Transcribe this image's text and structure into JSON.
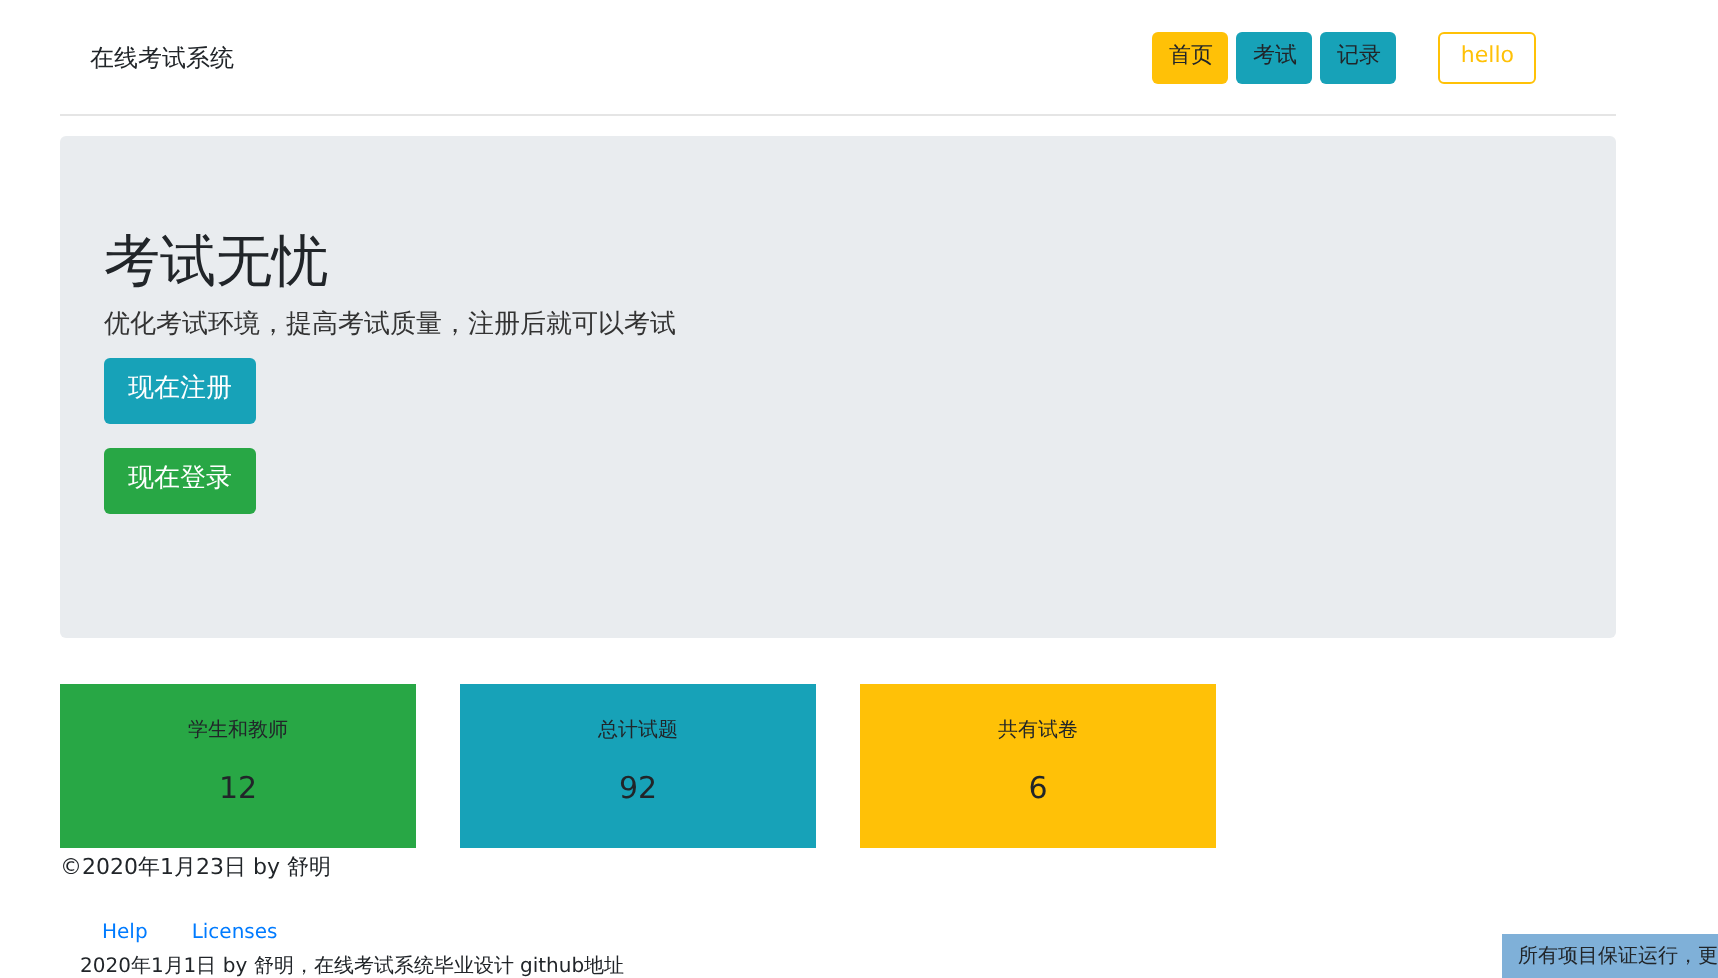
{
  "brand": "在线考试系统",
  "nav": [
    {
      "label": "首页",
      "selected": true
    },
    {
      "label": "考试",
      "selected": false
    },
    {
      "label": "记录",
      "selected": false
    }
  ],
  "user_button": "hello",
  "hero": {
    "title": "考试无忧",
    "subtitle": "优化考试环境，提高考试质量，注册后就可以考试",
    "buttons": [
      {
        "label": "现在注册",
        "kind": "register"
      },
      {
        "label": "现在登录",
        "kind": "login"
      }
    ]
  },
  "stats": [
    {
      "label": "学生和教师",
      "value": "12",
      "color": "#28a745"
    },
    {
      "label": "总计试题",
      "value": "92",
      "color": "#17a2b8"
    },
    {
      "label": "共有试卷",
      "value": "6",
      "color": "#ffc107"
    }
  ],
  "copyright": "©2020年1月23日 by 舒明",
  "footer_links": [
    "Help",
    "Licenses"
  ],
  "footer_note": "2020年1月1日 by 舒明，在线考试系统毕业设计 github地址",
  "notice": "所有项目保证运行，更"
}
